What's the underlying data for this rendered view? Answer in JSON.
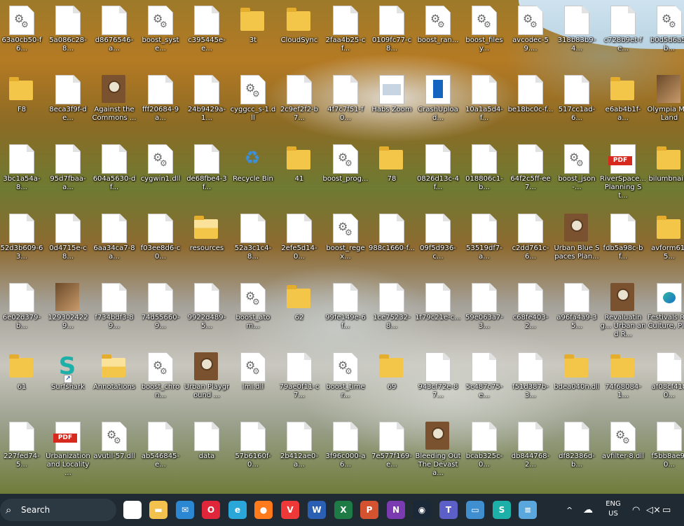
{
  "desktop": {
    "rows": [
      [
        {
          "label": "63a0cb50-f6...",
          "icon": "gear-file-icon"
        },
        {
          "label": "5a086c28-8...",
          "icon": "file-icon"
        },
        {
          "label": "d8676546-a...",
          "icon": "file-icon"
        },
        {
          "label": "boost_syste...",
          "icon": "gear-file-icon"
        },
        {
          "label": "c395445e-e...",
          "icon": "file-icon"
        },
        {
          "label": "3t",
          "icon": "folder-icon"
        },
        {
          "label": "CloudSync",
          "icon": "folder-icon"
        },
        {
          "label": "2faa4b25-cf...",
          "icon": "file-icon"
        },
        {
          "label": "0109fc77-c8...",
          "icon": "file-icon"
        },
        {
          "label": "boost_ran...",
          "icon": "gear-file-icon"
        },
        {
          "label": "boost_filesy...",
          "icon": "gear-file-icon"
        },
        {
          "label": "avcodec-59....",
          "icon": "gear-file-icon"
        },
        {
          "label": "318b83b9-4...",
          "icon": "file-icon"
        },
        {
          "label": "c728b9et-fe...",
          "icon": "file-icon"
        },
        {
          "label": "b0d5d6a5-b...",
          "icon": "gear-file-icon"
        }
      ],
      [
        {
          "label": "F8",
          "icon": "folder-icon"
        },
        {
          "label": "8eca3f9f-de...",
          "icon": "file-icon"
        },
        {
          "label": "Against the Commons ...",
          "icon": "book-icon"
        },
        {
          "label": "fff20684-9a...",
          "icon": "file-icon"
        },
        {
          "label": "24b9429a-1...",
          "icon": "file-icon"
        },
        {
          "label": "cyggcc_s-1.dll",
          "icon": "gear-file-icon"
        },
        {
          "label": "2c9ef2f2-b7...",
          "icon": "file-icon"
        },
        {
          "label": "4f7c7f51-f0...",
          "icon": "file-icon"
        },
        {
          "label": "Habs Zoom",
          "icon": "app-window-icon"
        },
        {
          "label": "CrashUpload...",
          "icon": "crash-uploader-icon"
        },
        {
          "label": "10a1a5d4-f...",
          "icon": "file-icon"
        },
        {
          "label": "be18bc0c-f...",
          "icon": "file-icon"
        },
        {
          "label": "517cc1ad-6...",
          "icon": "file-icon"
        },
        {
          "label": "e6ab4b1f-a...",
          "icon": "folder-icon"
        },
        {
          "label": "Olympia M... Land",
          "icon": "photo-icon"
        }
      ],
      [
        {
          "label": "3bc1a54a-8...",
          "icon": "file-icon"
        },
        {
          "label": "95d7fbaa-a...",
          "icon": "file-icon"
        },
        {
          "label": "604a5630-df...",
          "icon": "file-icon"
        },
        {
          "label": "cygwin1.dll",
          "icon": "gear-file-icon"
        },
        {
          "label": "de68fbe4-3f...",
          "icon": "file-icon"
        },
        {
          "label": "Recycle Bin",
          "icon": "recycle-bin-icon"
        },
        {
          "label": "41",
          "icon": "folder-icon"
        },
        {
          "label": "boost_prog...",
          "icon": "gear-file-icon"
        },
        {
          "label": "78",
          "icon": "folder-icon"
        },
        {
          "label": "0826d13c-4f...",
          "icon": "file-icon"
        },
        {
          "label": "018806c1-b...",
          "icon": "file-icon"
        },
        {
          "label": "64f2c5ff-ee7...",
          "icon": "file-icon"
        },
        {
          "label": "boost_json-...",
          "icon": "gear-file-icon"
        },
        {
          "label": "RiverSpace... Planning St...",
          "icon": "pdf-icon"
        },
        {
          "label": "bilumbnai...",
          "icon": "folder-icon"
        }
      ],
      [
        {
          "label": "52d3b609-63...",
          "icon": "file-icon"
        },
        {
          "label": "0d4715e-c8...",
          "icon": "file-icon"
        },
        {
          "label": "6aa34ca7-8a...",
          "icon": "file-icon"
        },
        {
          "label": "f03ee8d6-c0...",
          "icon": "file-icon"
        },
        {
          "label": "resources",
          "icon": "folder-open-icon"
        },
        {
          "label": "52a3c1c4-8...",
          "icon": "file-icon"
        },
        {
          "label": "2efe5d14-0...",
          "icon": "file-icon"
        },
        {
          "label": "boost_regex...",
          "icon": "gear-file-icon"
        },
        {
          "label": "988c1660-f...",
          "icon": "file-icon"
        },
        {
          "label": "09f5d936-c...",
          "icon": "file-icon"
        },
        {
          "label": "53519df7-a...",
          "icon": "file-icon"
        },
        {
          "label": "c2dd761c-6...",
          "icon": "file-icon"
        },
        {
          "label": "Urban Blue Spaces Plan...",
          "icon": "book-icon"
        },
        {
          "label": "fdb5a98c-bf...",
          "icon": "file-icon"
        },
        {
          "label": "avform61-5...",
          "icon": "folder-icon"
        }
      ],
      [
        {
          "label": "6e02d379-b...",
          "icon": "file-icon"
        },
        {
          "label": "1293024229...",
          "icon": "photo-icon"
        },
        {
          "label": "f734bdf3-89...",
          "icon": "file-icon"
        },
        {
          "label": "74d55660-9...",
          "icon": "file-icon"
        },
        {
          "label": "9922d489-5...",
          "icon": "file-icon"
        },
        {
          "label": "boost_atom...",
          "icon": "gear-file-icon"
        },
        {
          "label": "62",
          "icon": "folder-icon"
        },
        {
          "label": "99fe149e-6f...",
          "icon": "file-icon"
        },
        {
          "label": "1ce75232-8...",
          "icon": "file-icon"
        },
        {
          "label": "1f79c21e-c...",
          "icon": "file-icon"
        },
        {
          "label": "59e063a7-3...",
          "icon": "file-icon"
        },
        {
          "label": "c68fe403-2...",
          "icon": "file-icon"
        },
        {
          "label": "a96fa4a9-35...",
          "icon": "file-icon"
        },
        {
          "label": "Revaluating... Urban and R...",
          "icon": "book-icon"
        },
        {
          "label": "Festivals R... Culture, Pl...",
          "icon": "edge-doc-icon"
        }
      ],
      [
        {
          "label": "61",
          "icon": "folder-icon"
        },
        {
          "label": "Surfshark",
          "icon": "surfshark-icon"
        },
        {
          "label": "Annotations",
          "icon": "folder-open-icon"
        },
        {
          "label": "boost_chron...",
          "icon": "gear-file-icon"
        },
        {
          "label": "Urban Playground ...",
          "icon": "book-icon"
        },
        {
          "label": "lmi.dll",
          "icon": "gear-file-icon"
        },
        {
          "label": "79ae0f11-c7...",
          "icon": "file-icon"
        },
        {
          "label": "boost_timer...",
          "icon": "gear-file-icon"
        },
        {
          "label": "69",
          "icon": "folder-icon"
        },
        {
          "label": "943cf72e-87...",
          "icon": "file-icon"
        },
        {
          "label": "5c487c75-e...",
          "icon": "file-icon"
        },
        {
          "label": "f51d387b-3...",
          "icon": "file-icon"
        },
        {
          "label": "bdea040n.dll",
          "icon": "folder-icon"
        },
        {
          "label": "74f68084-1...",
          "icon": "folder-icon"
        },
        {
          "label": "af08cf4180...",
          "icon": "file-icon"
        }
      ],
      [
        {
          "label": "227fed74-5...",
          "icon": "file-icon"
        },
        {
          "label": "Urbanization and Locality ...",
          "icon": "pdf-icon"
        },
        {
          "label": "avutil-57.dll",
          "icon": "gear-file-icon"
        },
        {
          "label": "ab546845-e...",
          "icon": "file-icon"
        },
        {
          "label": "data",
          "icon": "file-icon"
        },
        {
          "label": "57b6160f-0...",
          "icon": "file-icon"
        },
        {
          "label": "2b412ae0-a...",
          "icon": "file-icon"
        },
        {
          "label": "3f96c000-a6...",
          "icon": "file-icon"
        },
        {
          "label": "7e577f169-e...",
          "icon": "file-icon"
        },
        {
          "label": "Bleeding Out The Devasta...",
          "icon": "book-icon"
        },
        {
          "label": "bcab325c-0...",
          "icon": "file-icon"
        },
        {
          "label": "db844768-2...",
          "icon": "file-icon"
        },
        {
          "label": "df82386d-b...",
          "icon": "file-icon"
        },
        {
          "label": "avfilter-8.dll",
          "icon": "gear-file-icon"
        },
        {
          "label": "f5bb8ae9-0...",
          "icon": "file-icon"
        }
      ]
    ]
  },
  "taskbar": {
    "search_placeholder": "Search",
    "pdf_badge": "PDF",
    "apps": [
      {
        "name": "task-view",
        "glyph": "▣",
        "color": "#ffffff"
      },
      {
        "name": "file-explorer",
        "glyph": "▬",
        "color": "#f2c14e"
      },
      {
        "name": "mail",
        "glyph": "✉",
        "color": "#2b87d1"
      },
      {
        "name": "opera",
        "glyph": "O",
        "color": "#e0263a"
      },
      {
        "name": "edge",
        "glyph": "e",
        "color": "#2aa6d8"
      },
      {
        "name": "firefox",
        "glyph": "●",
        "color": "#ff7a1a"
      },
      {
        "name": "vivaldi",
        "glyph": "V",
        "color": "#ef3939"
      },
      {
        "name": "word",
        "glyph": "W",
        "color": "#2b5fb4"
      },
      {
        "name": "excel",
        "glyph": "X",
        "color": "#1e7b45"
      },
      {
        "name": "powerpoint",
        "glyph": "P",
        "color": "#d35230"
      },
      {
        "name": "onenote",
        "glyph": "N",
        "color": "#7a3bb0"
      },
      {
        "name": "steam",
        "glyph": "◉",
        "color": "#1b2838"
      },
      {
        "name": "teams",
        "glyph": "T",
        "color": "#5b5fc7"
      },
      {
        "name": "remote-desktop",
        "glyph": "▭",
        "color": "#3f8fd0"
      },
      {
        "name": "surfshark",
        "glyph": "S",
        "color": "#1cb0a9"
      },
      {
        "name": "notepad",
        "glyph": "≡",
        "color": "#5aa7dd"
      }
    ],
    "tray": {
      "chevron": "^",
      "lang_top": "ENG",
      "lang_bottom": "US"
    }
  }
}
